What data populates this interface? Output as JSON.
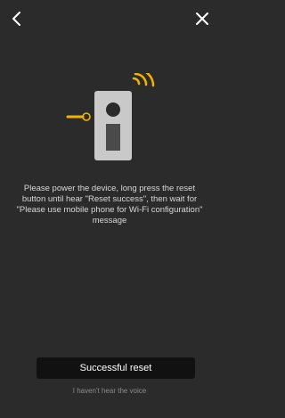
{
  "icons": {
    "back": "chevron-left-icon",
    "close": "close-icon"
  },
  "colors": {
    "background": "#2b2b2b",
    "accent": "#f0b400",
    "device_body": "#c9c9c9",
    "device_panel": "#4a4a4a",
    "button_bg": "#111111"
  },
  "instruction": {
    "text": "Please power the device, long press the reset button until hear \"Reset success\", then wait for \"Please use mobile phone for Wi-Fi configuration\" message"
  },
  "actions": {
    "primary_label": "Successful reset",
    "secondary_label": "I haven't hear the voice"
  }
}
